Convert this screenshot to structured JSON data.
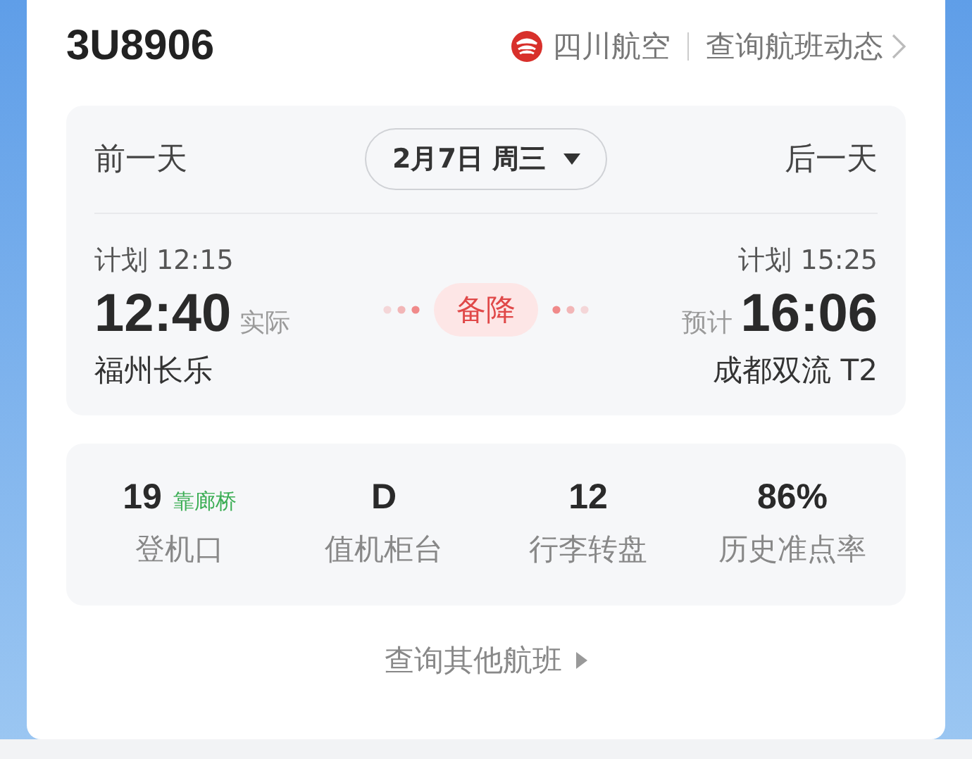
{
  "flight": {
    "number": "3U8906",
    "airline": "四川航空",
    "status_link": "查询航班动态"
  },
  "date_bar": {
    "prev": "前一天",
    "date": "2月7日 周三",
    "next": "后一天"
  },
  "departure": {
    "planned": "计划 12:15",
    "time": "12:40",
    "time_note": "实际",
    "airport": "福州长乐"
  },
  "status": {
    "label": "备降"
  },
  "arrival": {
    "planned": "计划 15:25",
    "time": "16:06",
    "time_note": "预计",
    "airport": "成都双流 T2"
  },
  "stats": [
    {
      "value": "19",
      "tag": "靠廊桥",
      "label": "登机口"
    },
    {
      "value": "D",
      "label": "值机柜台"
    },
    {
      "value": "12",
      "label": "行李转盘"
    },
    {
      "value": "86%",
      "label": "历史准点率"
    }
  ],
  "other_flights": "查询其他航班"
}
